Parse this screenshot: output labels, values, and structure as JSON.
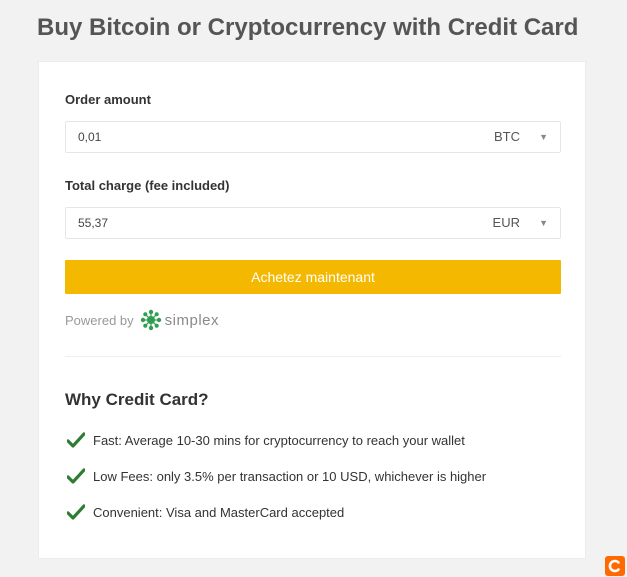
{
  "page": {
    "title": "Buy Bitcoin or Cryptocurrency with Credit Card"
  },
  "order": {
    "amount_label": "Order amount",
    "amount_value": "0,01",
    "amount_currency": "BTC",
    "charge_label": "Total charge (fee included)",
    "charge_value": "55,37",
    "charge_currency": "EUR",
    "buy_button_label": "Achetez maintenant"
  },
  "powered": {
    "text": "Powered by",
    "brand": "simplex"
  },
  "why": {
    "title": "Why Credit Card?",
    "items": [
      "Fast: Average 10-30 mins for cryptocurrency to reach your wallet",
      "Low Fees: only 3.5% per transaction or 10 USD, whichever is higher",
      "Convenient: Visa and MasterCard accepted"
    ]
  },
  "icons": {
    "caret": "chevron-down-icon",
    "check": "checkmark-icon",
    "simplex": "simplex-logo-icon",
    "corner": "badge-icon"
  },
  "colors": {
    "accent": "#f4b800",
    "check": "#2e7d32",
    "simplex": "#2e9e4f",
    "badge": "#ff6a00"
  }
}
